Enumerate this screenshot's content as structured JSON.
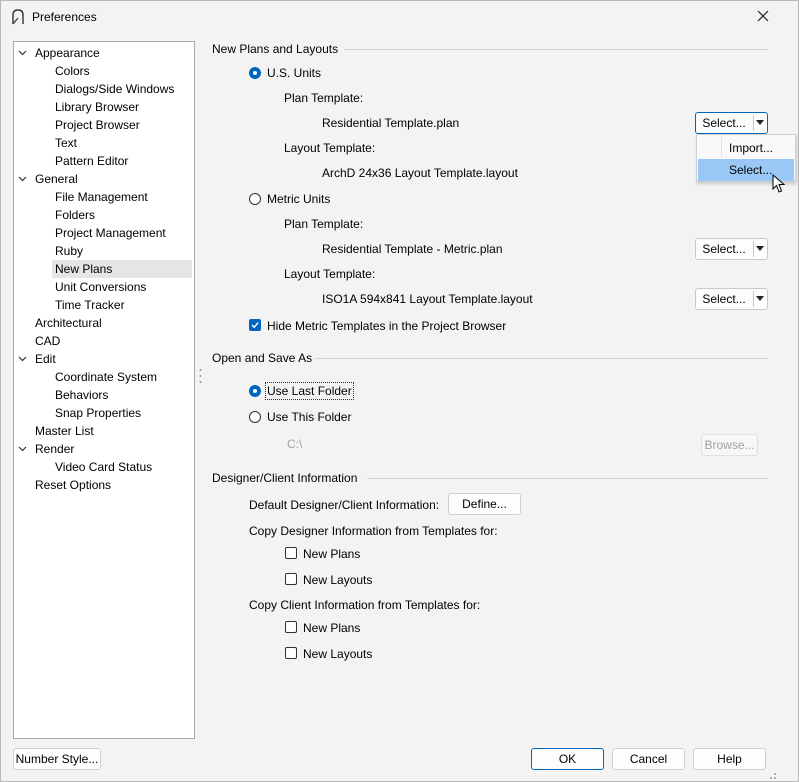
{
  "window": {
    "title": "Preferences"
  },
  "tree": [
    {
      "label": "Appearance",
      "level": 0,
      "expanded": true
    },
    {
      "label": "Colors",
      "level": 1
    },
    {
      "label": "Dialogs/Side Windows",
      "level": 1
    },
    {
      "label": "Library Browser",
      "level": 1
    },
    {
      "label": "Project Browser",
      "level": 1
    },
    {
      "label": "Text",
      "level": 1
    },
    {
      "label": "Pattern Editor",
      "level": 1
    },
    {
      "label": "General",
      "level": 0,
      "expanded": true
    },
    {
      "label": "File Management",
      "level": 1
    },
    {
      "label": "Folders",
      "level": 1
    },
    {
      "label": "Project Management",
      "level": 1
    },
    {
      "label": "Ruby",
      "level": 1
    },
    {
      "label": "New Plans",
      "level": 1,
      "selected": true
    },
    {
      "label": "Unit Conversions",
      "level": 1
    },
    {
      "label": "Time Tracker",
      "level": 1
    },
    {
      "label": "Architectural",
      "level": 0
    },
    {
      "label": "CAD",
      "level": 0
    },
    {
      "label": "Edit",
      "level": 0,
      "expanded": true
    },
    {
      "label": "Coordinate System",
      "level": 1
    },
    {
      "label": "Behaviors",
      "level": 1
    },
    {
      "label": "Snap Properties",
      "level": 1
    },
    {
      "label": "Master List",
      "level": 0
    },
    {
      "label": "Render",
      "level": 0,
      "expanded": true
    },
    {
      "label": "Video Card Status",
      "level": 1
    },
    {
      "label": "Reset Options",
      "level": 0
    }
  ],
  "new_plans": {
    "heading": "New Plans and Layouts",
    "us_units": "U.S. Units",
    "plan_template_label": "Plan Template:",
    "us_plan_template": "Residential Template.plan",
    "layout_template_label": "Layout Template:",
    "us_layout_template": "ArchD 24x36 Layout Template.layout",
    "metric_units": "Metric Units",
    "metric_plan_template": "Residential Template - Metric.plan",
    "metric_layout_template": "ISO1A 594x841 Layout Template.layout",
    "select_label": "Select...",
    "hide_metric": "Hide Metric Templates in the Project Browser",
    "hide_metric_checked": true,
    "selected_units": "U.S. Units"
  },
  "dropdown": {
    "items": [
      "Import...",
      "Select..."
    ],
    "highlighted": "Select..."
  },
  "open_save": {
    "heading": "Open and Save As",
    "use_last": "Use Last Folder",
    "use_this": "Use This Folder",
    "path": "C:\\",
    "browse": "Browse...",
    "selected": "Use Last Folder"
  },
  "designer": {
    "heading": "Designer/Client Information",
    "default_label": "Default Designer/Client Information:",
    "define": "Define...",
    "copy_designer": "Copy Designer Information from Templates for:",
    "copy_client": "Copy Client Information from Templates for:",
    "new_plans": "New Plans",
    "new_layouts": "New Layouts"
  },
  "footer": {
    "number_style": "Number Style...",
    "ok": "OK",
    "cancel": "Cancel",
    "help": "Help"
  },
  "colors": {
    "accent": "#0067c0",
    "highlight": "#99c8f5",
    "tree_selected": "#e5e5e5"
  }
}
